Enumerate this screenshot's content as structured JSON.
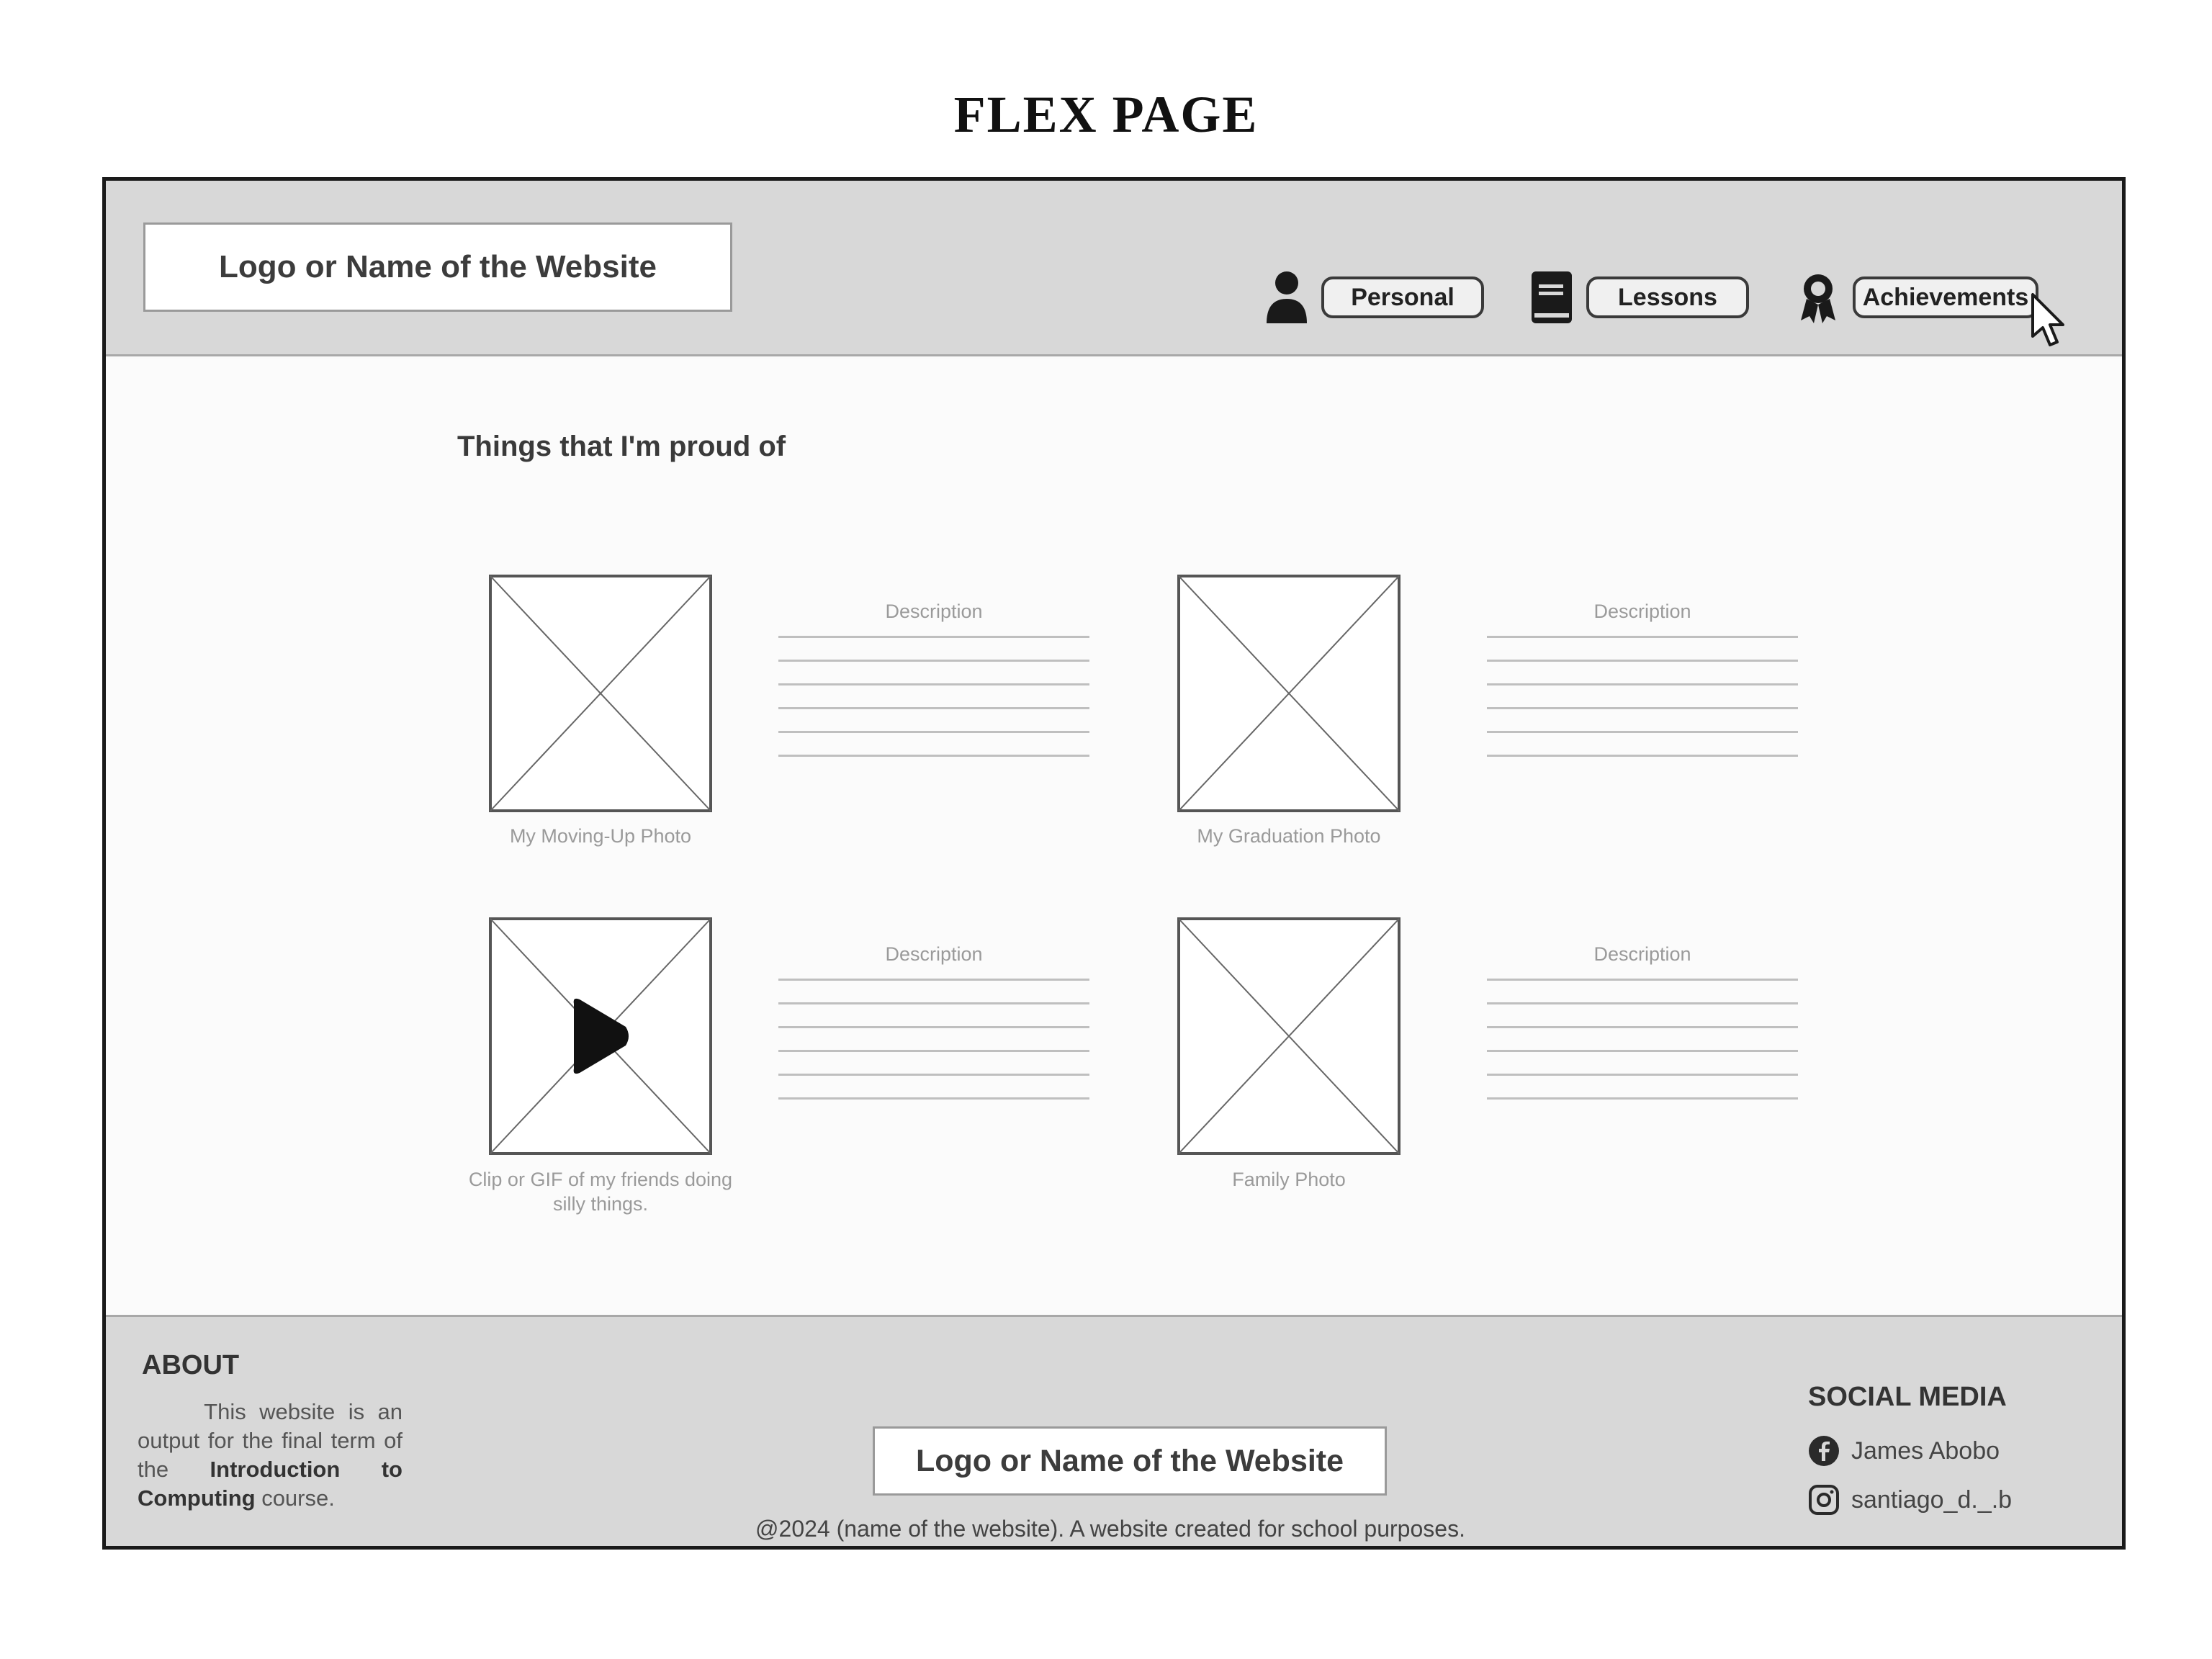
{
  "page": {
    "title": "FLEX PAGE"
  },
  "header": {
    "logo_text": "Logo or Name of the Website",
    "nav": [
      {
        "label": "Personal",
        "icon": "person-icon"
      },
      {
        "label": "Lessons",
        "icon": "book-icon"
      },
      {
        "label": "Achievements",
        "icon": "award-icon"
      }
    ]
  },
  "main": {
    "section_title": "Things that I'm proud of",
    "cards": [
      {
        "caption": "My Moving-Up Photo",
        "media": "image-placeholder",
        "description_label": "Description"
      },
      {
        "caption": "My Graduation Photo",
        "media": "image-placeholder",
        "description_label": "Description"
      },
      {
        "caption": "Clip or GIF of my friends doing silly things.",
        "media": "video-placeholder",
        "description_label": "Description"
      },
      {
        "caption": "Family Photo",
        "media": "image-placeholder",
        "description_label": "Description"
      }
    ]
  },
  "footer": {
    "about_title": "ABOUT",
    "about_text_1": "This website is an output for the final term of the ",
    "about_text_bold_1": "Introduction to Computing",
    "about_text_2": " course.",
    "logo_text": "Logo or Name of the Website",
    "copyright": "@2024 (name of the website). A website created for school purposes.",
    "social_title": "SOCIAL MEDIA",
    "social": [
      {
        "label": "James Abobo",
        "icon": "facebook-icon"
      },
      {
        "label": "santiago_d._.b",
        "icon": "instagram-icon"
      }
    ]
  },
  "colors": {
    "header_bg": "#d8d8d8",
    "footer_bg": "#d8d8d8",
    "frame_border": "#1a1a1a"
  }
}
